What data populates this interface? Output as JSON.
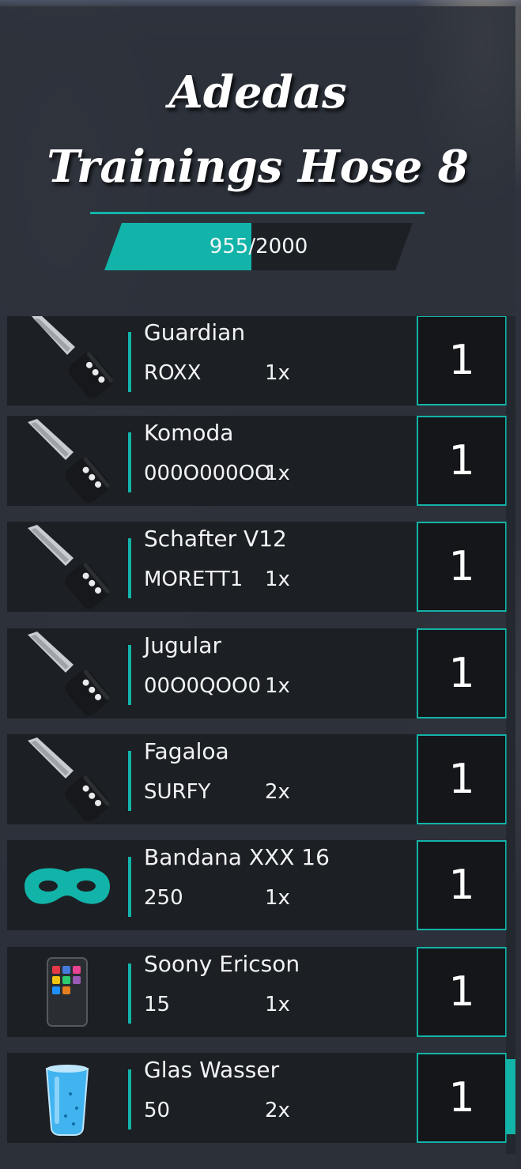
{
  "inventory": {
    "title_line1": "Adedas",
    "title_line2": "Trainings Hose 8",
    "weight_text": "955/2000",
    "weight_fraction": 0.4775,
    "accent_color": "#12b3a8",
    "items": [
      {
        "name": "Guardian",
        "code": "ROXX",
        "count": "1x",
        "qty": "1",
        "icon": "car-key-icon"
      },
      {
        "name": "Komoda",
        "code": "000O000OO",
        "count": "1x",
        "qty": "1",
        "icon": "car-key-icon"
      },
      {
        "name": "Schafter V12",
        "code": "MORETT1",
        "count": "1x",
        "qty": "1",
        "icon": "car-key-icon"
      },
      {
        "name": "Jugular",
        "code": "00O0QOO0",
        "count": "1x",
        "qty": "1",
        "icon": "car-key-icon"
      },
      {
        "name": "Fagaloa",
        "code": "SURFY",
        "count": "2x",
        "qty": "1",
        "icon": "car-key-icon"
      },
      {
        "name": "Bandana XXX 16",
        "code": "250",
        "count": "1x",
        "qty": "1",
        "icon": "mask-icon"
      },
      {
        "name": "Soony Ericson",
        "code": "15",
        "count": "1x",
        "qty": "1",
        "icon": "phone-icon"
      },
      {
        "name": "Glas Wasser",
        "code": "50",
        "count": "2x",
        "qty": "1",
        "icon": "water-glass-icon"
      }
    ]
  }
}
